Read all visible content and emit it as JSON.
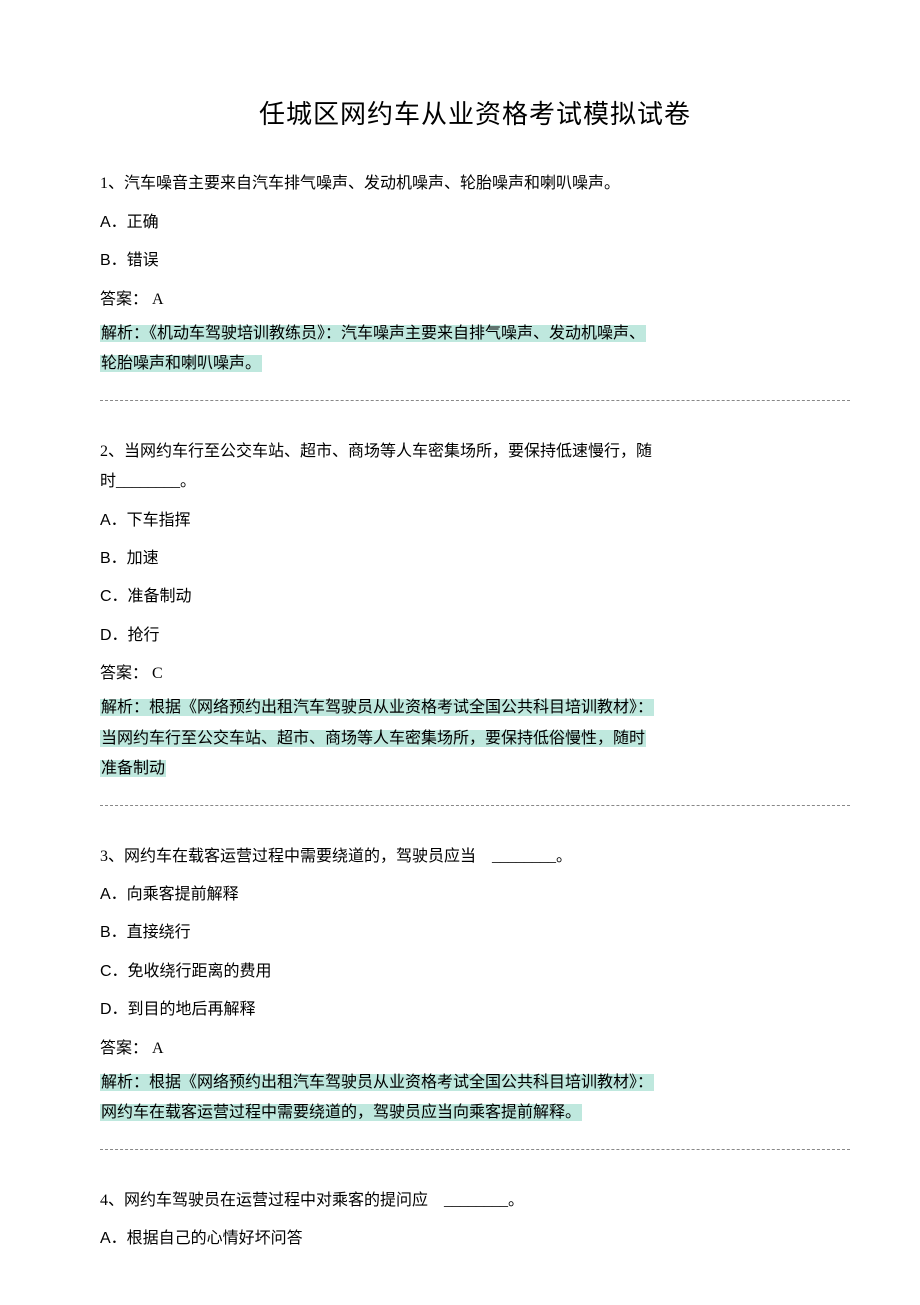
{
  "title": "任城区网约车从业资格考试模拟试卷",
  "q1": {
    "text": "1、汽车噪音主要来自汽车排气噪声、发动机噪声、轮胎噪声和喇叭噪声。",
    "optA": "A．正确",
    "optB": "B．错误",
    "answer": "答案： A",
    "exp1": "解析：《机动车驾驶培训教练员》：汽车噪声主要来自排气噪声、发动机噪声、",
    "exp2": "轮胎噪声和喇叭噪声。"
  },
  "q2": {
    "text1": "2、当网约车行至公交车站、超市、商场等人车密集场所，要保持低速慢行，随",
    "text2": "时________。",
    "optA": "A．下车指挥",
    "optB": "B．加速",
    "optC": "C．准备制动",
    "optD": "D．抢行",
    "answer": "答案： C",
    "exp1": "解析：根据《网络预约出租汽车驾驶员从业资格考试全国公共科目培训教材》：",
    "exp2": "当网约车行至公交车站、超市、商场等人车密集场所，要保持低俗慢性，随时",
    "exp3": "准备制动"
  },
  "q3": {
    "text": "3、网约车在载客运营过程中需要绕道的，驾驶员应当　________。",
    "optA": "A．向乘客提前解释",
    "optB": "B．直接绕行",
    "optC": "C．免收绕行距离的费用",
    "optD": "D．到目的地后再解释",
    "answer": "答案： A",
    "exp1": "解析：根据《网络预约出租汽车驾驶员从业资格考试全国公共科目培训教材》：",
    "exp2": "网约车在载客运营过程中需要绕道的，驾驶员应当向乘客提前解释。"
  },
  "q4": {
    "text": "4、网约车驾驶员在运营过程中对乘客的提问应　________。",
    "optA": "A．根据自己的心情好坏问答"
  }
}
